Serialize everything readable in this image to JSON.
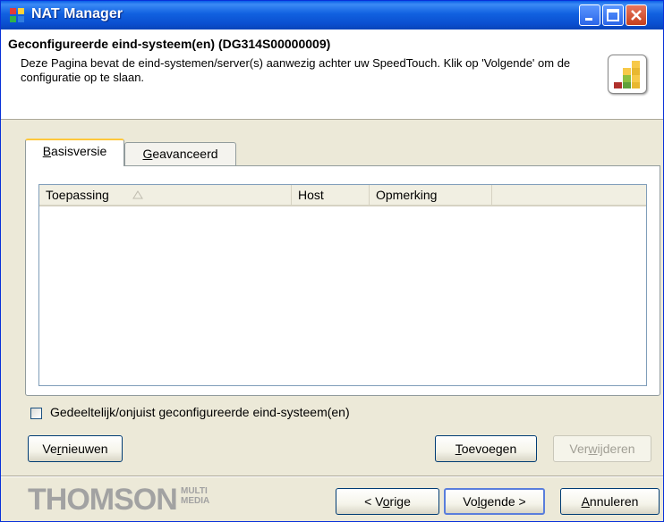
{
  "window": {
    "title": "NAT Manager",
    "buttons": {
      "minimize": "minimize-icon",
      "maximize": "maximize-icon",
      "close": "close-icon"
    }
  },
  "header": {
    "title": "Geconfigureerde eind-systeem(en) (DG314S00000009)",
    "description": "Deze Pagina bevat de eind-systemen/server(s) aanwezig achter uw SpeedTouch. Klik op 'Volgende' om de configuratie op te slaan."
  },
  "tabs": [
    {
      "mnemonic": "B",
      "rest": "asisversie",
      "active": true
    },
    {
      "mnemonic": "G",
      "rest": "eavanceerd",
      "active": false
    }
  ],
  "list": {
    "columns": [
      "Toepassing",
      "Host",
      "Opmerking",
      ""
    ],
    "sort_icon": "sort-ascending-icon",
    "rows": []
  },
  "checkbox": {
    "label": "Gedeeltelijk/onjuist geconfigureerde eind-systeem(en)",
    "checked": false
  },
  "buttons": {
    "refresh": {
      "pre": "Ve",
      "mnemonic": "r",
      "post": "nieuwen"
    },
    "add": {
      "pre": "",
      "mnemonic": "T",
      "post": "oevoegen"
    },
    "remove": {
      "pre": "Ver",
      "mnemonic": "w",
      "post": "ijderen",
      "enabled": false
    },
    "prev": {
      "pre": "< V",
      "mnemonic": "o",
      "post": "rige"
    },
    "next": {
      "pre": "Vo",
      "mnemonic": "l",
      "post": "gende >"
    },
    "cancel": {
      "pre": "",
      "mnemonic": "A",
      "post": "nnuleren"
    }
  },
  "brand": {
    "name": "THOMSON",
    "sub_line1": "MULTI",
    "sub_line2": "MEDIA"
  },
  "colors": {
    "titlebar": "#0a4fd0",
    "dialog_bg": "#ece9d8",
    "tab_highlight": "#ffc83c",
    "logo_gray": "#a2a2a2"
  }
}
